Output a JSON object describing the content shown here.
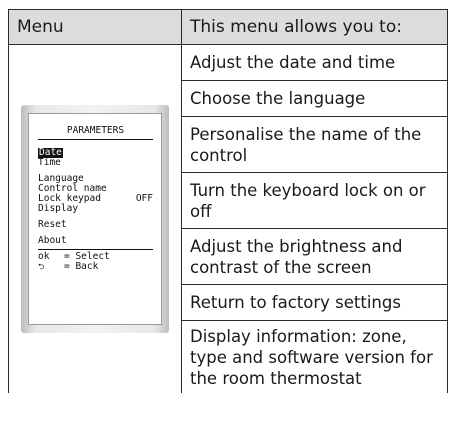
{
  "header": {
    "col1": "Menu",
    "col2": "This menu allows you to:"
  },
  "screen": {
    "title": "PARAMETERS",
    "items": {
      "date": "Date",
      "time": "Time",
      "language": "Language",
      "control_name": "Control name",
      "lock_keypad": "Lock keypad",
      "lock_keypad_value": "OFF",
      "display": "Display",
      "reset": "Reset",
      "about": "About"
    },
    "hints": {
      "ok_key": "ok",
      "ok_label": "= Select",
      "back_key": "⮌",
      "back_label": "= Back"
    }
  },
  "rows": [
    "Adjust the date and time",
    "Choose the language",
    "Personalise the name of the control",
    "Turn the keyboard lock on or off",
    "Adjust the brightness and contrast of the screen",
    "Return to factory settings",
    "Display information: zone, type and software version for the room thermostat"
  ]
}
